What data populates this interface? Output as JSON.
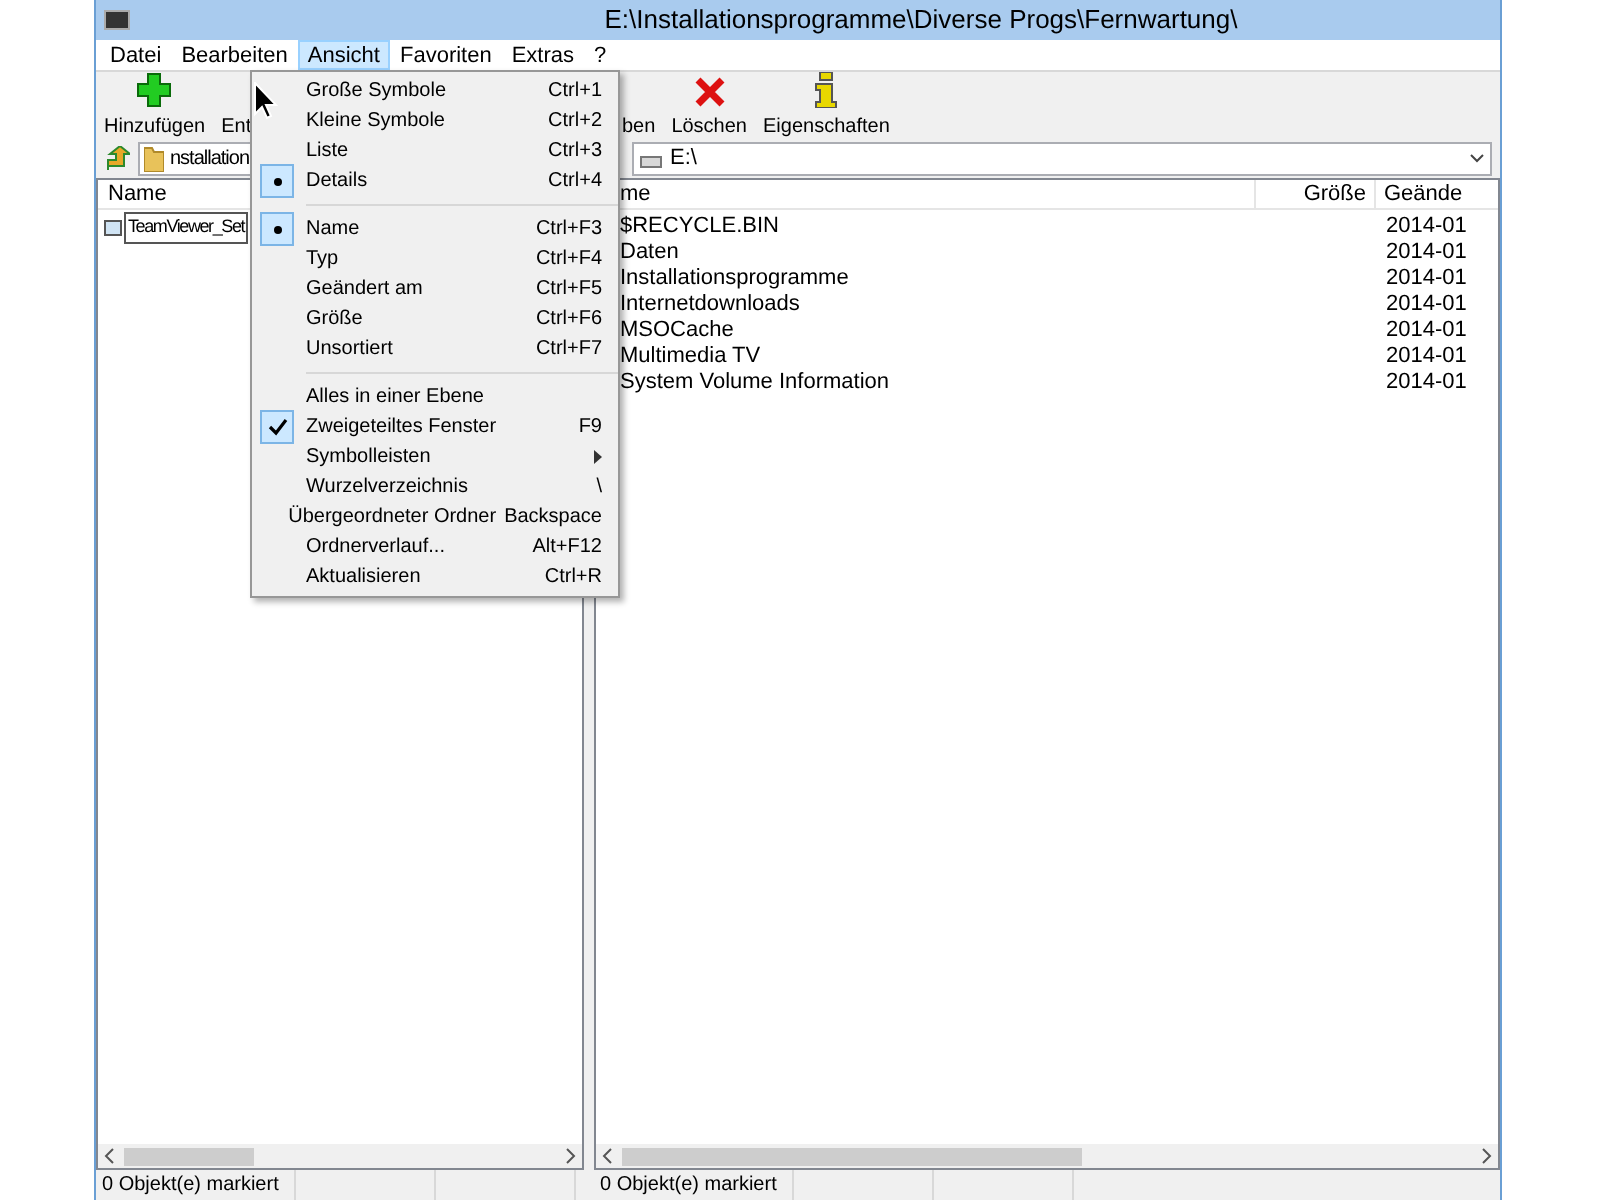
{
  "window": {
    "title": "E:\\Installationsprogramme\\Diverse Progs\\Fernwartung\\"
  },
  "menubar": [
    {
      "label": "Datei",
      "selected": false
    },
    {
      "label": "Bearbeiten",
      "selected": false
    },
    {
      "label": "Ansicht",
      "selected": true
    },
    {
      "label": "Favoriten",
      "selected": false
    },
    {
      "label": "Extras",
      "selected": false
    },
    {
      "label": "?",
      "selected": false
    }
  ],
  "toolbar_left": [
    {
      "label": "Hinzufügen",
      "kind": "add"
    },
    {
      "label": "Ent",
      "kind": "none"
    }
  ],
  "toolbar_right": [
    {
      "label": "ben",
      "kind": "none"
    },
    {
      "label": "Löschen",
      "kind": "delete"
    },
    {
      "label": "Eigenschaften",
      "kind": "info"
    }
  ],
  "left_panel": {
    "path": "nstallation",
    "columns": [
      "Name"
    ],
    "rows": [
      {
        "name": "TeamViewer_Set",
        "editing": true
      }
    ],
    "status": "0 Objekt(e) markiert"
  },
  "right_panel": {
    "path": "E:\\",
    "columns": [
      "me",
      "Größe",
      "Geände"
    ],
    "rows": [
      {
        "name": "$RECYCLE.BIN",
        "date": "2014-01"
      },
      {
        "name": "Daten",
        "date": "2014-01"
      },
      {
        "name": "Installationsprogramme",
        "date": "2014-01"
      },
      {
        "name": "Internetdownloads",
        "date": "2014-01"
      },
      {
        "name": "MSOCache",
        "date": "2014-01"
      },
      {
        "name": "Multimedia TV",
        "date": "2014-01"
      },
      {
        "name": "System Volume Information",
        "date": "2014-01"
      }
    ],
    "status": "0 Objekt(e) markiert"
  },
  "menu": [
    {
      "kind": "radio",
      "label": "Große Symbole",
      "shortcut": "Ctrl+1",
      "checked": false
    },
    {
      "kind": "radio",
      "label": "Kleine Symbole",
      "shortcut": "Ctrl+2",
      "checked": false
    },
    {
      "kind": "radio",
      "label": "Liste",
      "shortcut": "Ctrl+3",
      "checked": false
    },
    {
      "kind": "radio",
      "label": "Details",
      "shortcut": "Ctrl+4",
      "checked": true
    },
    {
      "kind": "separator"
    },
    {
      "kind": "radio",
      "label": "Name",
      "shortcut": "Ctrl+F3",
      "checked": true
    },
    {
      "kind": "radio",
      "label": "Typ",
      "shortcut": "Ctrl+F4",
      "checked": false
    },
    {
      "kind": "radio",
      "label": "Geändert am",
      "shortcut": "Ctrl+F5",
      "checked": false
    },
    {
      "kind": "radio",
      "label": "Größe",
      "shortcut": "Ctrl+F6",
      "checked": false
    },
    {
      "kind": "radio",
      "label": "Unsortiert",
      "shortcut": "Ctrl+F7",
      "checked": false
    },
    {
      "kind": "separator"
    },
    {
      "kind": "check",
      "label": "Alles in einer Ebene",
      "checked": false
    },
    {
      "kind": "check",
      "label": "Zweigeteiltes Fenster",
      "shortcut": "F9",
      "checked": true
    },
    {
      "kind": "submenu",
      "label": "Symbolleisten"
    },
    {
      "kind": "item",
      "label": "Wurzelverzeichnis",
      "shortcut": "\\"
    },
    {
      "kind": "item",
      "label": "Übergeordneter Ordner",
      "shortcut": "Backspace"
    },
    {
      "kind": "item",
      "label": "Ordnerverlauf...",
      "shortcut": "Alt+F12"
    },
    {
      "kind": "item",
      "label": "Aktualisieren",
      "shortcut": "Ctrl+R"
    }
  ]
}
